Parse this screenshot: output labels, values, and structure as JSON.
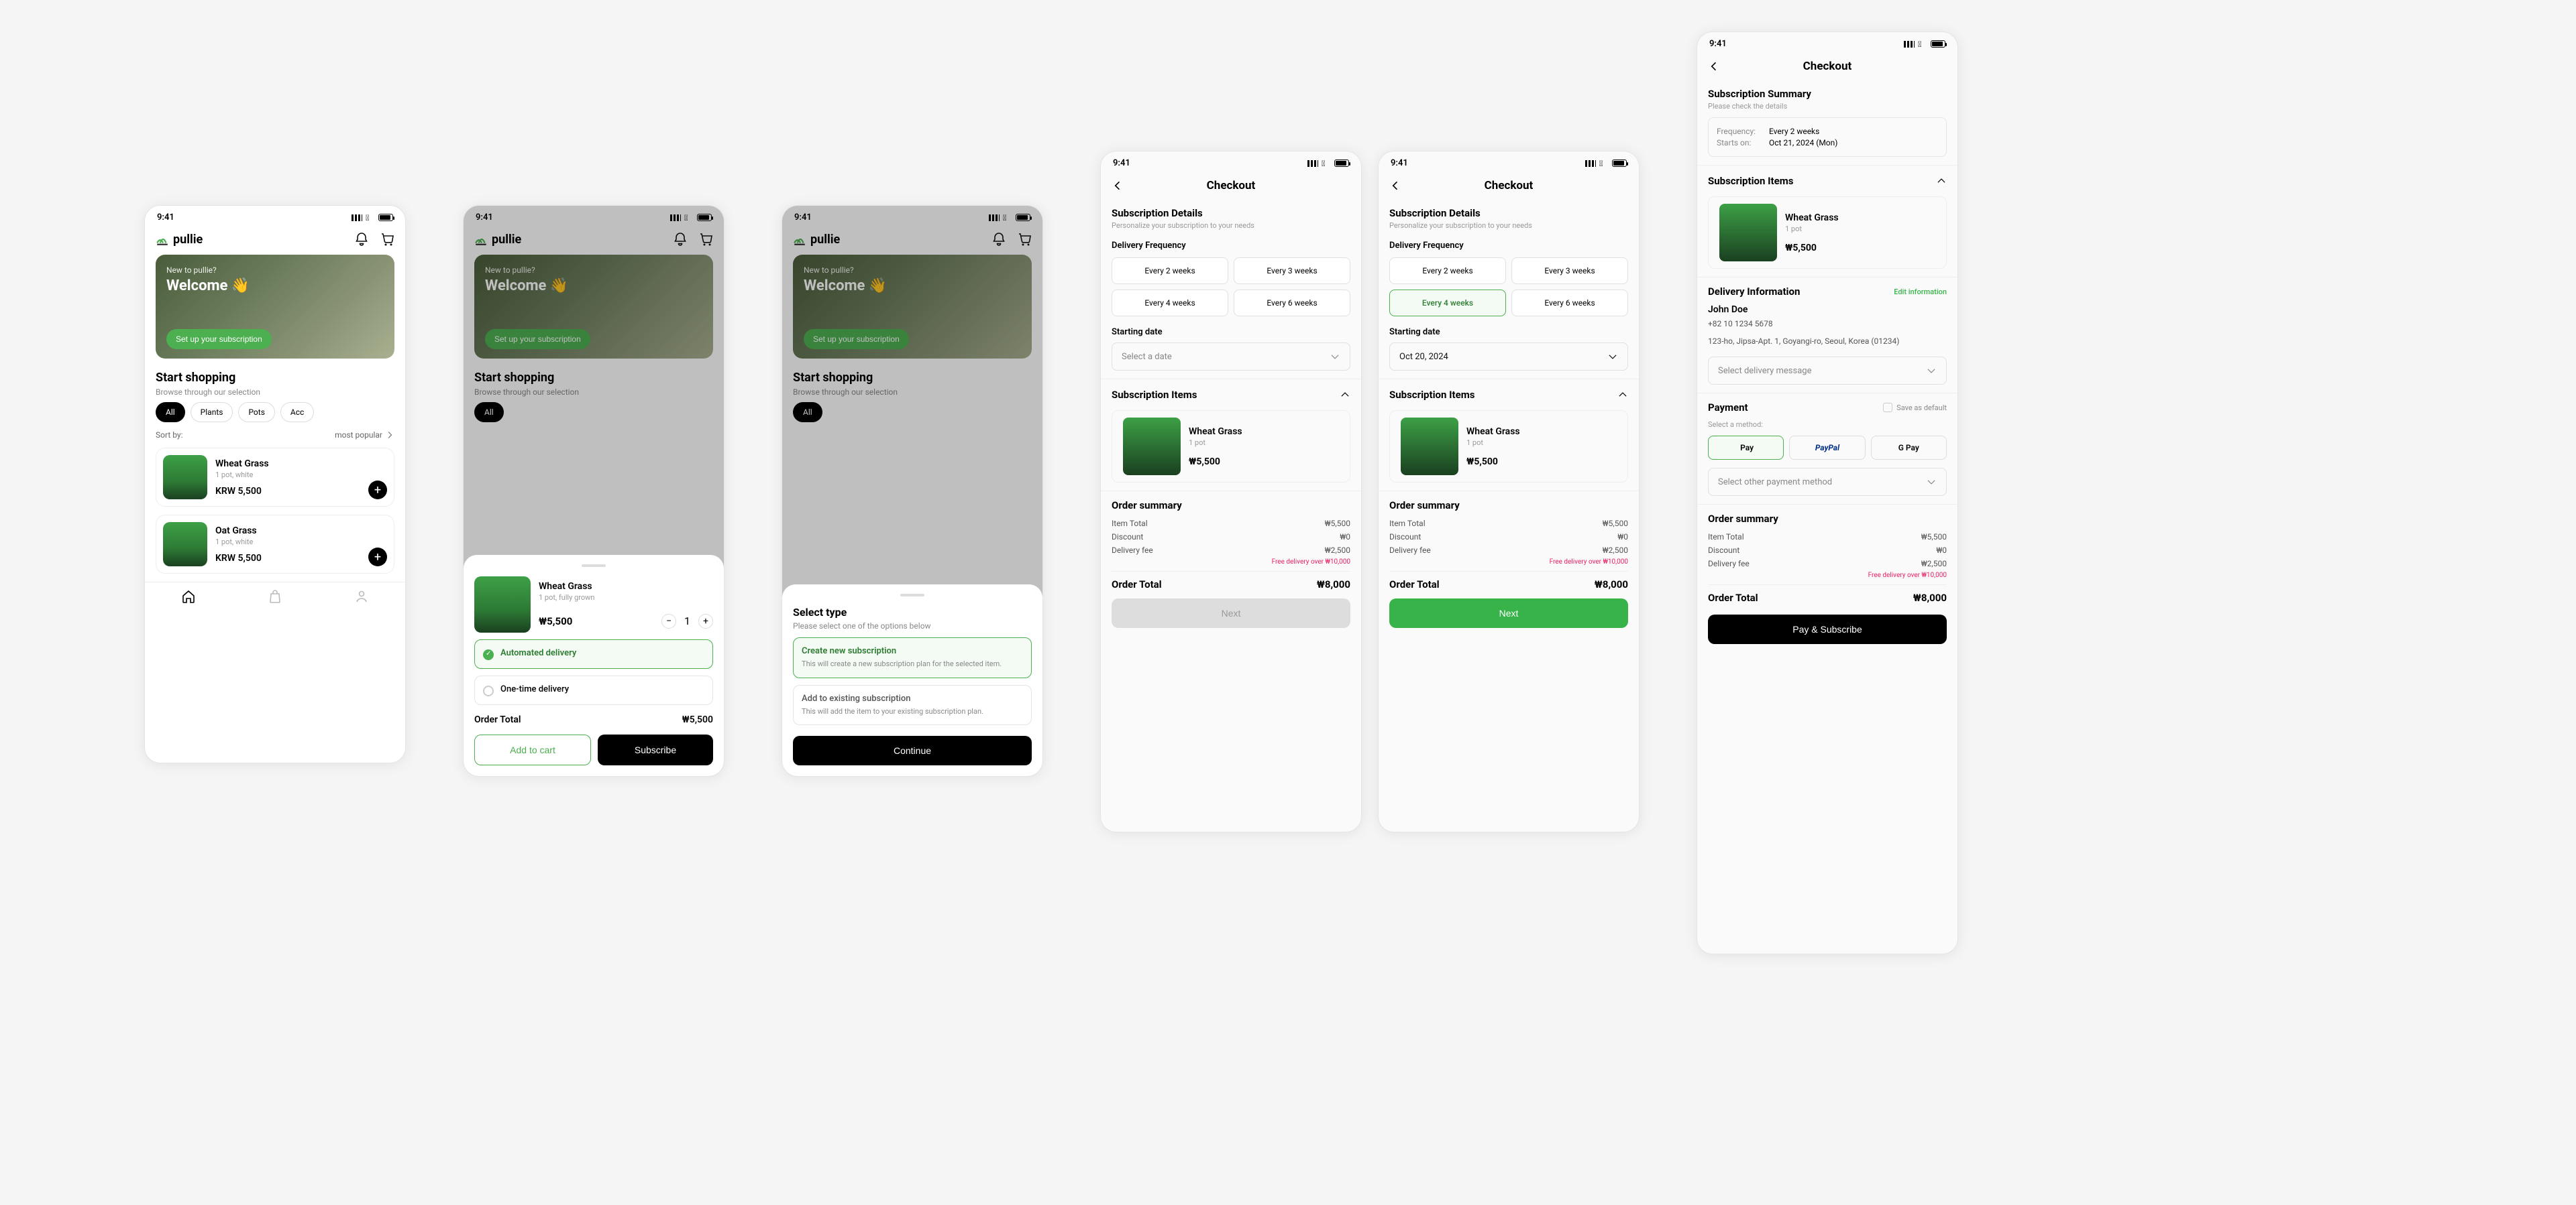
{
  "status_time": "9:41",
  "brand": "pullie",
  "hero": {
    "new": "New to pullie?",
    "welcome": "Welcome 👋",
    "cta": "Set up your subscription"
  },
  "shop": {
    "heading": "Start shopping",
    "sub": "Browse through our selection",
    "categories": [
      "All",
      "Plants",
      "Pots",
      "Acc"
    ],
    "sort_label": "Sort by:",
    "sort_value": "most popular",
    "products": [
      {
        "name": "Wheat Grass",
        "meta": "1 pot, white",
        "price": "KRW 5,500"
      },
      {
        "name": "Oat Grass",
        "meta": "1 pot, white",
        "price": "KRW 5,500"
      }
    ]
  },
  "sheet_item": {
    "name": "Wheat Grass",
    "meta": "1 pot, fully grown",
    "price": "₩5,500",
    "qty": "1",
    "opt_auto": "Automated delivery",
    "opt_once": "One-time delivery",
    "order_total_label": "Order Total",
    "order_total_value": "₩5,500",
    "btn_cart": "Add to cart",
    "btn_sub": "Subscribe"
  },
  "sheet_type": {
    "title": "Select type",
    "sub": "Please select one of the options below",
    "create_title": "Create new subscription",
    "create_desc": "This will create a new subscription plan for the selected item.",
    "add_title": "Add to existing subscription",
    "add_desc": "This will add the item to your existing subscription plan.",
    "continue": "Continue"
  },
  "checkout": {
    "title": "Checkout",
    "details_title": "Subscription Details",
    "details_sub": "Personalize your subscription to your needs",
    "freq_label": "Delivery Frequency",
    "freq": [
      "Every 2 weeks",
      "Every 3 weeks",
      "Every 4 weeks",
      "Every 6 weeks"
    ],
    "start_label": "Starting date",
    "start_placeholder": "Select a date",
    "start_value": "Oct 20, 2024",
    "items_title": "Subscription Items",
    "item_name": "Wheat Grass",
    "item_meta": "1 pot",
    "item_price": "₩5,500",
    "summary_title": "Order summary",
    "line_item": "Item Total",
    "line_item_v": "₩5,500",
    "line_disc": "Discount",
    "line_disc_v": "₩0",
    "line_del": "Delivery fee",
    "line_del_v": "₩2,500",
    "free_note": "Free delivery over ₩10,000",
    "total_label": "Order Total",
    "total_value": "₩8,000",
    "next": "Next"
  },
  "final": {
    "sum_title": "Subscription Summary",
    "sum_sub": "Please check the details",
    "freq_k": "Frequency:",
    "freq_v": "Every 2 weeks",
    "start_k": "Starts on:",
    "start_v": "Oct 21, 2024 (Mon)",
    "delivery_title": "Delivery Information",
    "edit": "Edit information",
    "name": "John Doe",
    "phone": "+82 10 1234 5678",
    "addr": "123-ho, Jipsa-Apt. 1, Goyangi-ro, Seoul, Korea (01234)",
    "del_msg": "Select delivery message",
    "pay_title": "Payment",
    "save_default": "Save as default",
    "pay_sub": "Select a method:",
    "apple_pay": "Pay",
    "paypal": "PayPal",
    "gpay": "G Pay",
    "other_method": "Select other payment method",
    "pay_btn": "Pay & Subscribe"
  }
}
